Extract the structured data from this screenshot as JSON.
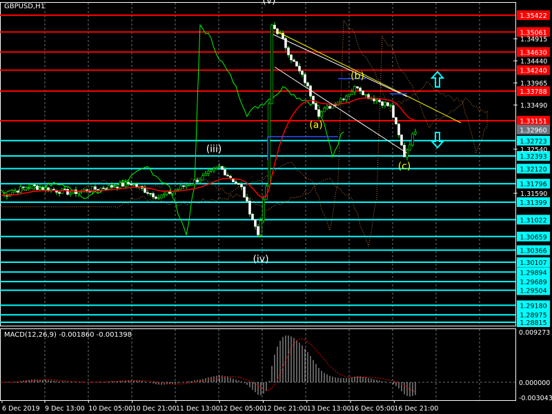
{
  "window": {
    "title": "GBPUSD,H1"
  },
  "macd": {
    "label": "MACD(12,26,9) -0.001860 -0.001398",
    "ticks": [
      "0.009273",
      "0.000000",
      "-0.003043"
    ]
  },
  "colors": {
    "bg": "#000000",
    "resistance": "#ff0000",
    "support": "#00ffff",
    "current": "#6b7580",
    "ma": "#ff0000",
    "chikou": "#00ff00",
    "cloud": "#ff9a50",
    "trend": "#ffff00",
    "wave_label": "#ffff00",
    "arrow": "#00ffff"
  },
  "chart_data": {
    "type": "candlestick",
    "symbol": "GBPUSD",
    "timeframe": "H1",
    "ylim": [
      1.287,
      1.3565
    ],
    "current_price": "1.32960",
    "price_levels": [
      {
        "value": "1.35422",
        "kind": "resistance"
      },
      {
        "value": "1.35061",
        "kind": "resistance"
      },
      {
        "value": "1.34630",
        "kind": "resistance"
      },
      {
        "value": "1.34240",
        "kind": "resistance"
      },
      {
        "value": "1.33788",
        "kind": "resistance"
      },
      {
        "value": "1.33151",
        "kind": "resistance"
      },
      {
        "value": "1.32723",
        "kind": "support"
      },
      {
        "value": "1.32393",
        "kind": "support"
      },
      {
        "value": "1.32120",
        "kind": "support"
      },
      {
        "value": "1.31796",
        "kind": "support"
      },
      {
        "value": "1.31399",
        "kind": "support"
      },
      {
        "value": "1.31022",
        "kind": "support"
      },
      {
        "value": "1.30659",
        "kind": "support"
      },
      {
        "value": "1.30366",
        "kind": "support"
      },
      {
        "value": "1.30107",
        "kind": "support"
      },
      {
        "value": "1.29894",
        "kind": "support"
      },
      {
        "value": "1.29689",
        "kind": "support"
      },
      {
        "value": "1.29504",
        "kind": "support"
      },
      {
        "value": "1.29180",
        "kind": "support"
      },
      {
        "value": "1.28975",
        "kind": "support"
      },
      {
        "value": "1.28815",
        "kind": "support"
      }
    ],
    "axis_ticks": [
      "1.34915",
      "1.34440",
      "1.33965",
      "1.33490",
      "1.32540",
      "1.31590"
    ],
    "time_labels": [
      "6 Dec 2019",
      "9 Dec 13:00",
      "10 Dec 05:00",
      "10 Dec 21:00",
      "11 Dec 13:00",
      "12 Dec 05:00",
      "12 Dec 21:00",
      "13 Dec 13:00",
      "16 Dec 05:00",
      "16 Dec 21:00"
    ],
    "price_path": [
      [
        1,
        1.3155
      ],
      [
        10,
        1.3175
      ],
      [
        25,
        1.316
      ],
      [
        47,
        1.318
      ],
      [
        57,
        1.315
      ],
      [
        72,
        1.319
      ],
      [
        79,
        1.3215
      ],
      [
        87,
        1.317
      ],
      [
        93,
        1.307
      ],
      [
        96,
        1.3175
      ],
      [
        98,
        1.352
      ],
      [
        101,
        1.35
      ],
      [
        105,
        1.345
      ],
      [
        110,
        1.34
      ],
      [
        115,
        1.333
      ],
      [
        120,
        1.335
      ],
      [
        125,
        1.337
      ],
      [
        129,
        1.339
      ],
      [
        132,
        1.337
      ],
      [
        136,
        1.336
      ],
      [
        141,
        1.3345
      ],
      [
        146,
        1.324
      ],
      [
        150,
        1.3296
      ]
    ],
    "wave_labels": [
      {
        "text": "(v)",
        "bar": 97,
        "price": 1.3575
      },
      {
        "text": "(iii)",
        "bar": 77,
        "price": 1.3255
      },
      {
        "text": "(iv)",
        "bar": 94,
        "price": 1.3018
      },
      {
        "text": "(a)",
        "bar": 114,
        "price": 1.3307
      },
      {
        "text": "(b)",
        "bar": 129,
        "price": 1.3412
      },
      {
        "text": "(c)",
        "bar": 146,
        "price": 1.3218
      }
    ]
  }
}
